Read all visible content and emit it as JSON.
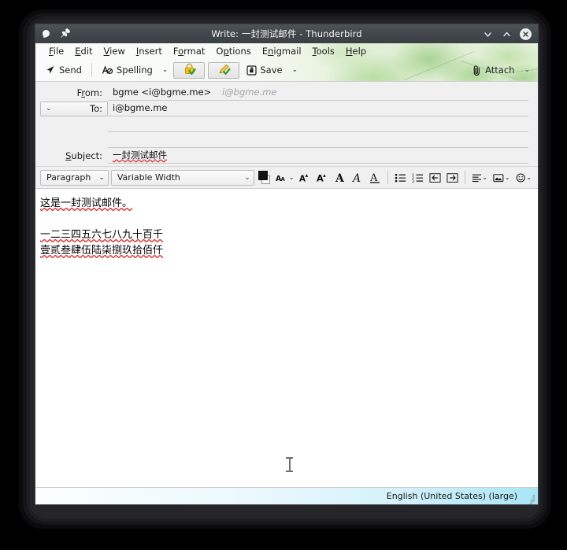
{
  "window": {
    "title": "Write: 一封测试邮件 - Thunderbird",
    "app_icon": "thunderbird-icon",
    "pin_icon": "pin-icon",
    "controls": {
      "minimize_label": "⌄",
      "maximize_label": "⌃",
      "close_label": "✕"
    }
  },
  "menubar": {
    "items": [
      {
        "label": "File",
        "accel": "F"
      },
      {
        "label": "Edit",
        "accel": "E"
      },
      {
        "label": "View",
        "accel": "V"
      },
      {
        "label": "Insert",
        "accel": "I"
      },
      {
        "label": "Format",
        "accel": "o"
      },
      {
        "label": "Options",
        "accel": "p"
      },
      {
        "label": "Enigmail",
        "accel": "n"
      },
      {
        "label": "Tools",
        "accel": "T"
      },
      {
        "label": "Help",
        "accel": "H"
      }
    ]
  },
  "toolbar": {
    "send_label": "Send",
    "send_icon": "send-paper-plane-icon",
    "spelling_label": "Spelling",
    "spelling_icon": "spellcheck-abc-icon",
    "spelling_dropdown_icon": "chevron-down-icon",
    "encrypt_icon": "padlock-check-icon",
    "sign_icon": "pencil-check-icon",
    "save_label": "Save",
    "save_icon": "save-disk-icon",
    "save_dropdown_icon": "chevron-down-icon",
    "attach_label": "Attach",
    "attach_icon": "paperclip-icon",
    "attach_dropdown_icon": "chevron-down-icon"
  },
  "headers": {
    "from": {
      "label": "From:",
      "accel": "r",
      "value": "bgme <i@bgme.me>",
      "identity_hint": "i@bgme.me"
    },
    "to": {
      "label": "To:",
      "twirl_icon": "chevron-down-icon",
      "value": "i@bgme.me"
    },
    "extra_rows": [
      "",
      ""
    ],
    "subject": {
      "label": "Subject:",
      "accel": "S",
      "value": "一封测试邮件"
    }
  },
  "formatbar": {
    "paragraph_select": {
      "value": "Paragraph",
      "arrow_icon": "chevron-down-icon"
    },
    "font_select": {
      "value": "Variable Width",
      "arrow_icon": "chevron-down-icon"
    },
    "color_swatch": {
      "name": "text-color-swatch",
      "foreground": "#111111",
      "background": "#ffffff"
    },
    "buttons": [
      {
        "name": "font-size-menu",
        "glyph": "A",
        "icon": "font-size-icon",
        "has_chevron": true
      },
      {
        "name": "decrease-font-size",
        "glyph": "A",
        "icon": "font-smaller-icon",
        "has_chevron": false
      },
      {
        "name": "increase-font-size",
        "glyph": "A",
        "icon": "font-larger-icon",
        "has_chevron": false
      },
      {
        "name": "bold",
        "glyph": "A",
        "icon": "bold-icon",
        "has_chevron": false
      },
      {
        "name": "italic",
        "glyph": "A",
        "icon": "italic-icon",
        "has_chevron": false
      },
      {
        "name": "underline",
        "glyph": "A",
        "icon": "underline-icon",
        "has_chevron": false
      },
      {
        "name": "bullet-list",
        "glyph": "☰",
        "icon": "bullet-list-icon",
        "has_chevron": false
      },
      {
        "name": "numbered-list",
        "glyph": "☰",
        "icon": "numbered-list-icon",
        "has_chevron": false
      },
      {
        "name": "outdent",
        "glyph": "⇤",
        "icon": "outdent-icon",
        "has_chevron": false
      },
      {
        "name": "indent",
        "glyph": "⇥",
        "icon": "indent-icon",
        "has_chevron": false
      },
      {
        "name": "align-menu",
        "glyph": "≡",
        "icon": "align-icon",
        "has_chevron": true
      },
      {
        "name": "insert-image-menu",
        "glyph": "▣",
        "icon": "image-icon",
        "has_chevron": true
      },
      {
        "name": "emoticon-menu",
        "glyph": "☺",
        "icon": "smiley-icon",
        "has_chevron": true
      }
    ]
  },
  "body": {
    "lines": [
      "这是一封测试邮件。",
      "",
      "一二三四五六七八九十百千",
      "壹贰叁肆伍陆柒捌玖拾佰仟"
    ],
    "cursor_icon": "text-ibeam-cursor"
  },
  "statusbar": {
    "language": "English (United States) (large)",
    "resize_grip_icon": "resize-grip-icon"
  }
}
